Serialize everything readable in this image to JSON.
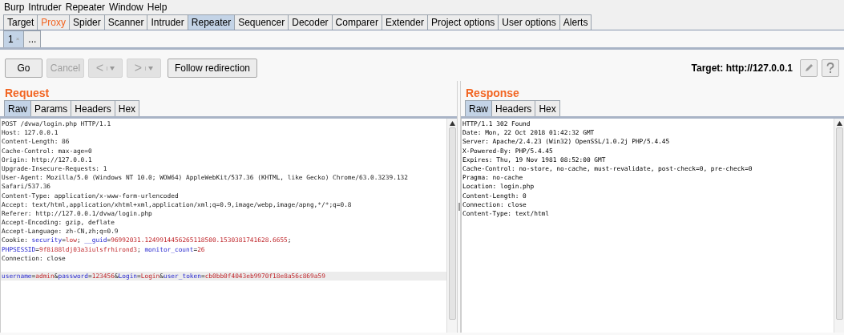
{
  "menu": [
    "Burp",
    "Intruder",
    "Repeater",
    "Window",
    "Help"
  ],
  "tabs": [
    {
      "label": "Target",
      "selected": false,
      "highlighted": false
    },
    {
      "label": "Proxy",
      "selected": false,
      "highlighted": true
    },
    {
      "label": "Spider",
      "selected": false,
      "highlighted": false
    },
    {
      "label": "Scanner",
      "selected": false,
      "highlighted": false
    },
    {
      "label": "Intruder",
      "selected": false,
      "highlighted": false
    },
    {
      "label": "Repeater",
      "selected": true,
      "highlighted": false
    },
    {
      "label": "Sequencer",
      "selected": false,
      "highlighted": false
    },
    {
      "label": "Decoder",
      "selected": false,
      "highlighted": false
    },
    {
      "label": "Comparer",
      "selected": false,
      "highlighted": false
    },
    {
      "label": "Extender",
      "selected": false,
      "highlighted": false
    },
    {
      "label": "Project options",
      "selected": false,
      "highlighted": false
    },
    {
      "label": "User options",
      "selected": false,
      "highlighted": false
    },
    {
      "label": "Alerts",
      "selected": false,
      "highlighted": false
    }
  ],
  "sub_tabs": [
    {
      "label": "1",
      "close": "×",
      "selected": true
    },
    {
      "label": "...",
      "selected": false
    }
  ],
  "toolbar": {
    "go": {
      "label": "Go",
      "disabled": false
    },
    "cancel": {
      "label": "Cancel",
      "disabled": true
    },
    "back": {
      "label": "<",
      "disabled": true
    },
    "forward": {
      "label": ">",
      "disabled": true
    },
    "follow": {
      "label": "Follow redirection",
      "disabled": false
    },
    "target": "Target: http://127.0.0.1"
  },
  "request": {
    "title": "Request",
    "tabs": [
      {
        "label": "Raw",
        "selected": true
      },
      {
        "label": "Params",
        "selected": false
      },
      {
        "label": "Headers",
        "selected": false
      },
      {
        "label": "Hex",
        "selected": false
      }
    ],
    "lines": [
      {
        "kind": "text",
        "current": false,
        "segments": [
          {
            "kind": "plain",
            "text": "POST /dvwa/login.php HTTP/1.1"
          }
        ]
      },
      {
        "kind": "text",
        "current": false,
        "segments": [
          {
            "kind": "plain",
            "text": "Host: 127.0.0.1"
          }
        ]
      },
      {
        "kind": "text",
        "current": false,
        "segments": [
          {
            "kind": "plain",
            "text": "Content-Length: 86"
          }
        ]
      },
      {
        "kind": "text",
        "current": false,
        "segments": [
          {
            "kind": "plain",
            "text": "Cache-Control: max-age=0"
          }
        ]
      },
      {
        "kind": "text",
        "current": false,
        "segments": [
          {
            "kind": "plain",
            "text": "Origin: http://127.0.0.1"
          }
        ]
      },
      {
        "kind": "text",
        "current": false,
        "segments": [
          {
            "kind": "plain",
            "text": "Upgrade-Insecure-Requests: 1"
          }
        ]
      },
      {
        "kind": "text",
        "current": false,
        "segments": [
          {
            "kind": "plain",
            "text": "User-Agent: Mozilla/5.0 (Windows NT 10.0; WOW64) AppleWebKit/537.36 (KHTML, like Gecko) Chrome/63.0.3239.132"
          }
        ]
      },
      {
        "kind": "text",
        "current": false,
        "segments": [
          {
            "kind": "plain",
            "text": "Safari/537.36"
          }
        ]
      },
      {
        "kind": "text",
        "current": false,
        "segments": [
          {
            "kind": "plain",
            "text": "Content-Type: application/x-www-form-urlencoded"
          }
        ]
      },
      {
        "kind": "text",
        "current": false,
        "segments": [
          {
            "kind": "plain",
            "text": "Accept: text/html,application/xhtml+xml,application/xml;q=0.9,image/webp,image/apng,*/*;q=0.8"
          }
        ]
      },
      {
        "kind": "text",
        "current": false,
        "segments": [
          {
            "kind": "plain",
            "text": "Referer: http://127.0.0.1/dvwa/login.php"
          }
        ]
      },
      {
        "kind": "text",
        "current": false,
        "segments": [
          {
            "kind": "plain",
            "text": "Accept-Encoding: gzip, deflate"
          }
        ]
      },
      {
        "kind": "text",
        "current": false,
        "segments": [
          {
            "kind": "plain",
            "text": "Accept-Language: zh-CN,zh;q=0.9"
          }
        ]
      },
      {
        "kind": "text",
        "current": false,
        "segments": [
          {
            "kind": "plain",
            "text": "Cookie: "
          },
          {
            "kind": "name",
            "text": "security"
          },
          {
            "kind": "plain",
            "text": "="
          },
          {
            "kind": "value",
            "text": "low"
          },
          {
            "kind": "plain",
            "text": "; "
          },
          {
            "kind": "name",
            "text": "__guid"
          },
          {
            "kind": "plain",
            "text": "="
          },
          {
            "kind": "value",
            "text": "96992031.1249914456265118500.1530381741628.6655"
          },
          {
            "kind": "plain",
            "text": ";"
          }
        ]
      },
      {
        "kind": "text",
        "current": false,
        "segments": [
          {
            "kind": "name",
            "text": "PHPSESSID"
          },
          {
            "kind": "plain",
            "text": "="
          },
          {
            "kind": "value",
            "text": "9f8i88ldj03a3iulsfrhirond3"
          },
          {
            "kind": "plain",
            "text": "; "
          },
          {
            "kind": "name",
            "text": "monitor_count"
          },
          {
            "kind": "plain",
            "text": "="
          },
          {
            "kind": "value",
            "text": "26"
          }
        ]
      },
      {
        "kind": "text",
        "current": false,
        "segments": [
          {
            "kind": "plain",
            "text": "Connection: close"
          }
        ]
      },
      {
        "kind": "blank",
        "current": false
      },
      {
        "kind": "text",
        "current": true,
        "segments": [
          {
            "kind": "name",
            "text": "username"
          },
          {
            "kind": "plain",
            "text": "="
          },
          {
            "kind": "value",
            "text": "admin"
          },
          {
            "kind": "plain",
            "text": "&"
          },
          {
            "kind": "name",
            "text": "password"
          },
          {
            "kind": "plain",
            "text": "="
          },
          {
            "kind": "value",
            "text": "123456"
          },
          {
            "kind": "plain",
            "text": "&"
          },
          {
            "kind": "name",
            "text": "Login"
          },
          {
            "kind": "plain",
            "text": "="
          },
          {
            "kind": "value",
            "text": "Login"
          },
          {
            "kind": "plain",
            "text": "&"
          },
          {
            "kind": "name",
            "text": "user_token"
          },
          {
            "kind": "plain",
            "text": "="
          },
          {
            "kind": "value",
            "text": "cb0bb0f4043eb9970f18e8a56c869a59"
          }
        ]
      }
    ]
  },
  "response": {
    "title": "Response",
    "tabs": [
      {
        "label": "Raw",
        "selected": true
      },
      {
        "label": "Headers",
        "selected": false
      },
      {
        "label": "Hex",
        "selected": false
      }
    ],
    "lines": [
      "HTTP/1.1 302 Found",
      "Date: Mon, 22 Oct 2018 01:42:32 GMT",
      "Server: Apache/2.4.23 (Win32) OpenSSL/1.0.2j PHP/5.4.45",
      "X-Powered-By: PHP/5.4.45",
      "Expires: Thu, 19 Nov 1981 08:52:00 GMT",
      "Cache-Control: no-store, no-cache, must-revalidate, post-check=0, pre-check=0",
      "Pragma: no-cache",
      "Location: login.php",
      "Content-Length: 0",
      "Connection: close",
      "Content-Type: text/html"
    ]
  }
}
